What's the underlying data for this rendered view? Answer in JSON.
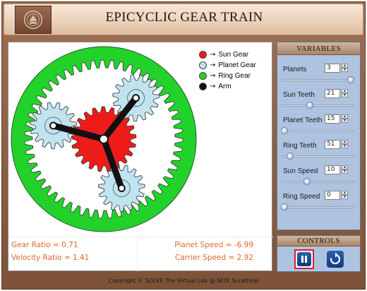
{
  "app": {
    "title": "EPICYCLIC GEAR TRAIN",
    "footer": "Copyright © SOLVE The Virtual Lab @ NITK Surathkal"
  },
  "legend": [
    {
      "color": "#ee1b1b",
      "arrow": "→",
      "label": "Sun Gear"
    },
    {
      "color": "#bfe3ef",
      "arrow": "→",
      "label": "Planet Gear"
    },
    {
      "color": "#22d22a",
      "arrow": "→",
      "label": "Ring Gear"
    },
    {
      "color": "#111111",
      "arrow": "→",
      "label": "Arm"
    }
  ],
  "readouts": {
    "gear_ratio": "Gear Ratio = 0.71",
    "velocity_ratio": "Velocity Ratio = 1.41",
    "planet_speed": "Planet Speed = -6.99",
    "carrier_speed": "Carrier Speed = 2.92"
  },
  "variables": {
    "title": "VARIABLES",
    "items": [
      {
        "key": "planets",
        "label": "Planets",
        "value": "3",
        "slider_fraction": 0.98
      },
      {
        "key": "sun_teeth",
        "label": "Sun Teeth",
        "value": "21",
        "slider_fraction": 0.38
      },
      {
        "key": "planet_teeth",
        "label": "Planet Teeth",
        "value": "15",
        "slider_fraction": 0.0
      },
      {
        "key": "ring_teeth",
        "label": "Ring Teeth",
        "value": "51",
        "slider_fraction": 0.08
      },
      {
        "key": "sun_speed",
        "label": "Sun Speed",
        "value": "10",
        "slider_fraction": 0.33
      },
      {
        "key": "ring_speed",
        "label": "Ring Speed",
        "value": "0",
        "slider_fraction": 0.0
      }
    ]
  },
  "controls": {
    "title": "CONTROLS"
  },
  "colors": {
    "sun": "#ee1b1b",
    "planet": "#bfe3ef",
    "ring": "#22d22a",
    "arm": "#111111",
    "readout_text": "#dc6a2a"
  },
  "icons": {
    "logo": "institute-seal",
    "pause": "pause-icon",
    "reset": "reset-icon"
  }
}
